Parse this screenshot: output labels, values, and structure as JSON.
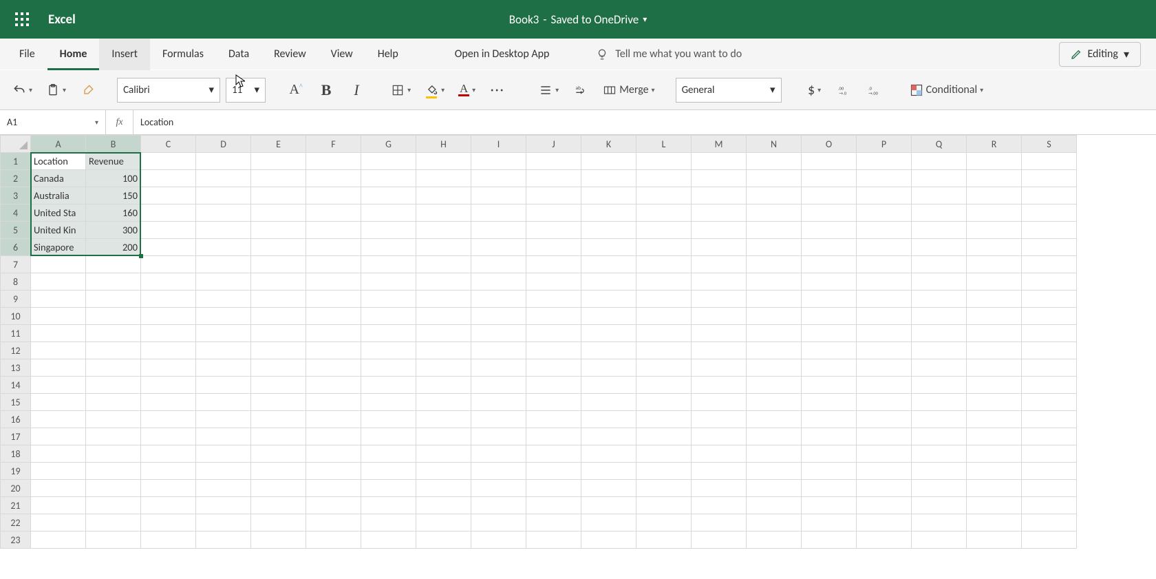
{
  "titlebar": {
    "app_name": "Excel",
    "doc_title": "Book3",
    "doc_status": "Saved to OneDrive"
  },
  "tabs": {
    "items": [
      "File",
      "Home",
      "Insert",
      "Formulas",
      "Data",
      "Review",
      "View",
      "Help"
    ],
    "open_desktop": "Open in Desktop App",
    "tell_me": "Tell me what you want to do",
    "editing": "Editing"
  },
  "ribbon": {
    "font_name": "Calibri",
    "font_size": "11",
    "merge_label": "Merge",
    "number_format": "General",
    "conditional_label": "Conditional"
  },
  "formulabar": {
    "cell_ref": "A1",
    "fx": "fx",
    "formula": "Location"
  },
  "grid": {
    "columns": [
      "A",
      "B",
      "C",
      "D",
      "E",
      "F",
      "G",
      "H",
      "I",
      "J",
      "K",
      "L",
      "M",
      "N",
      "O",
      "P",
      "Q",
      "R",
      "S"
    ],
    "row_count": 23,
    "data": [
      {
        "A": "Location",
        "B": "Revenue"
      },
      {
        "A": "Canada",
        "B": "100"
      },
      {
        "A": "Australia",
        "B": "150"
      },
      {
        "A": "United Sta",
        "B": "160"
      },
      {
        "A": "United Kin",
        "B": "300"
      },
      {
        "A": "Singapore",
        "B": "200"
      }
    ],
    "selection": {
      "from": "A1",
      "to": "B6",
      "active": "A1"
    }
  },
  "chart_data": {
    "type": "table",
    "columns": [
      "Location",
      "Revenue"
    ],
    "rows": [
      [
        "Canada",
        100
      ],
      [
        "Australia",
        150
      ],
      [
        "United Sta",
        160
      ],
      [
        "United Kin",
        300
      ],
      [
        "Singapore",
        200
      ]
    ]
  }
}
